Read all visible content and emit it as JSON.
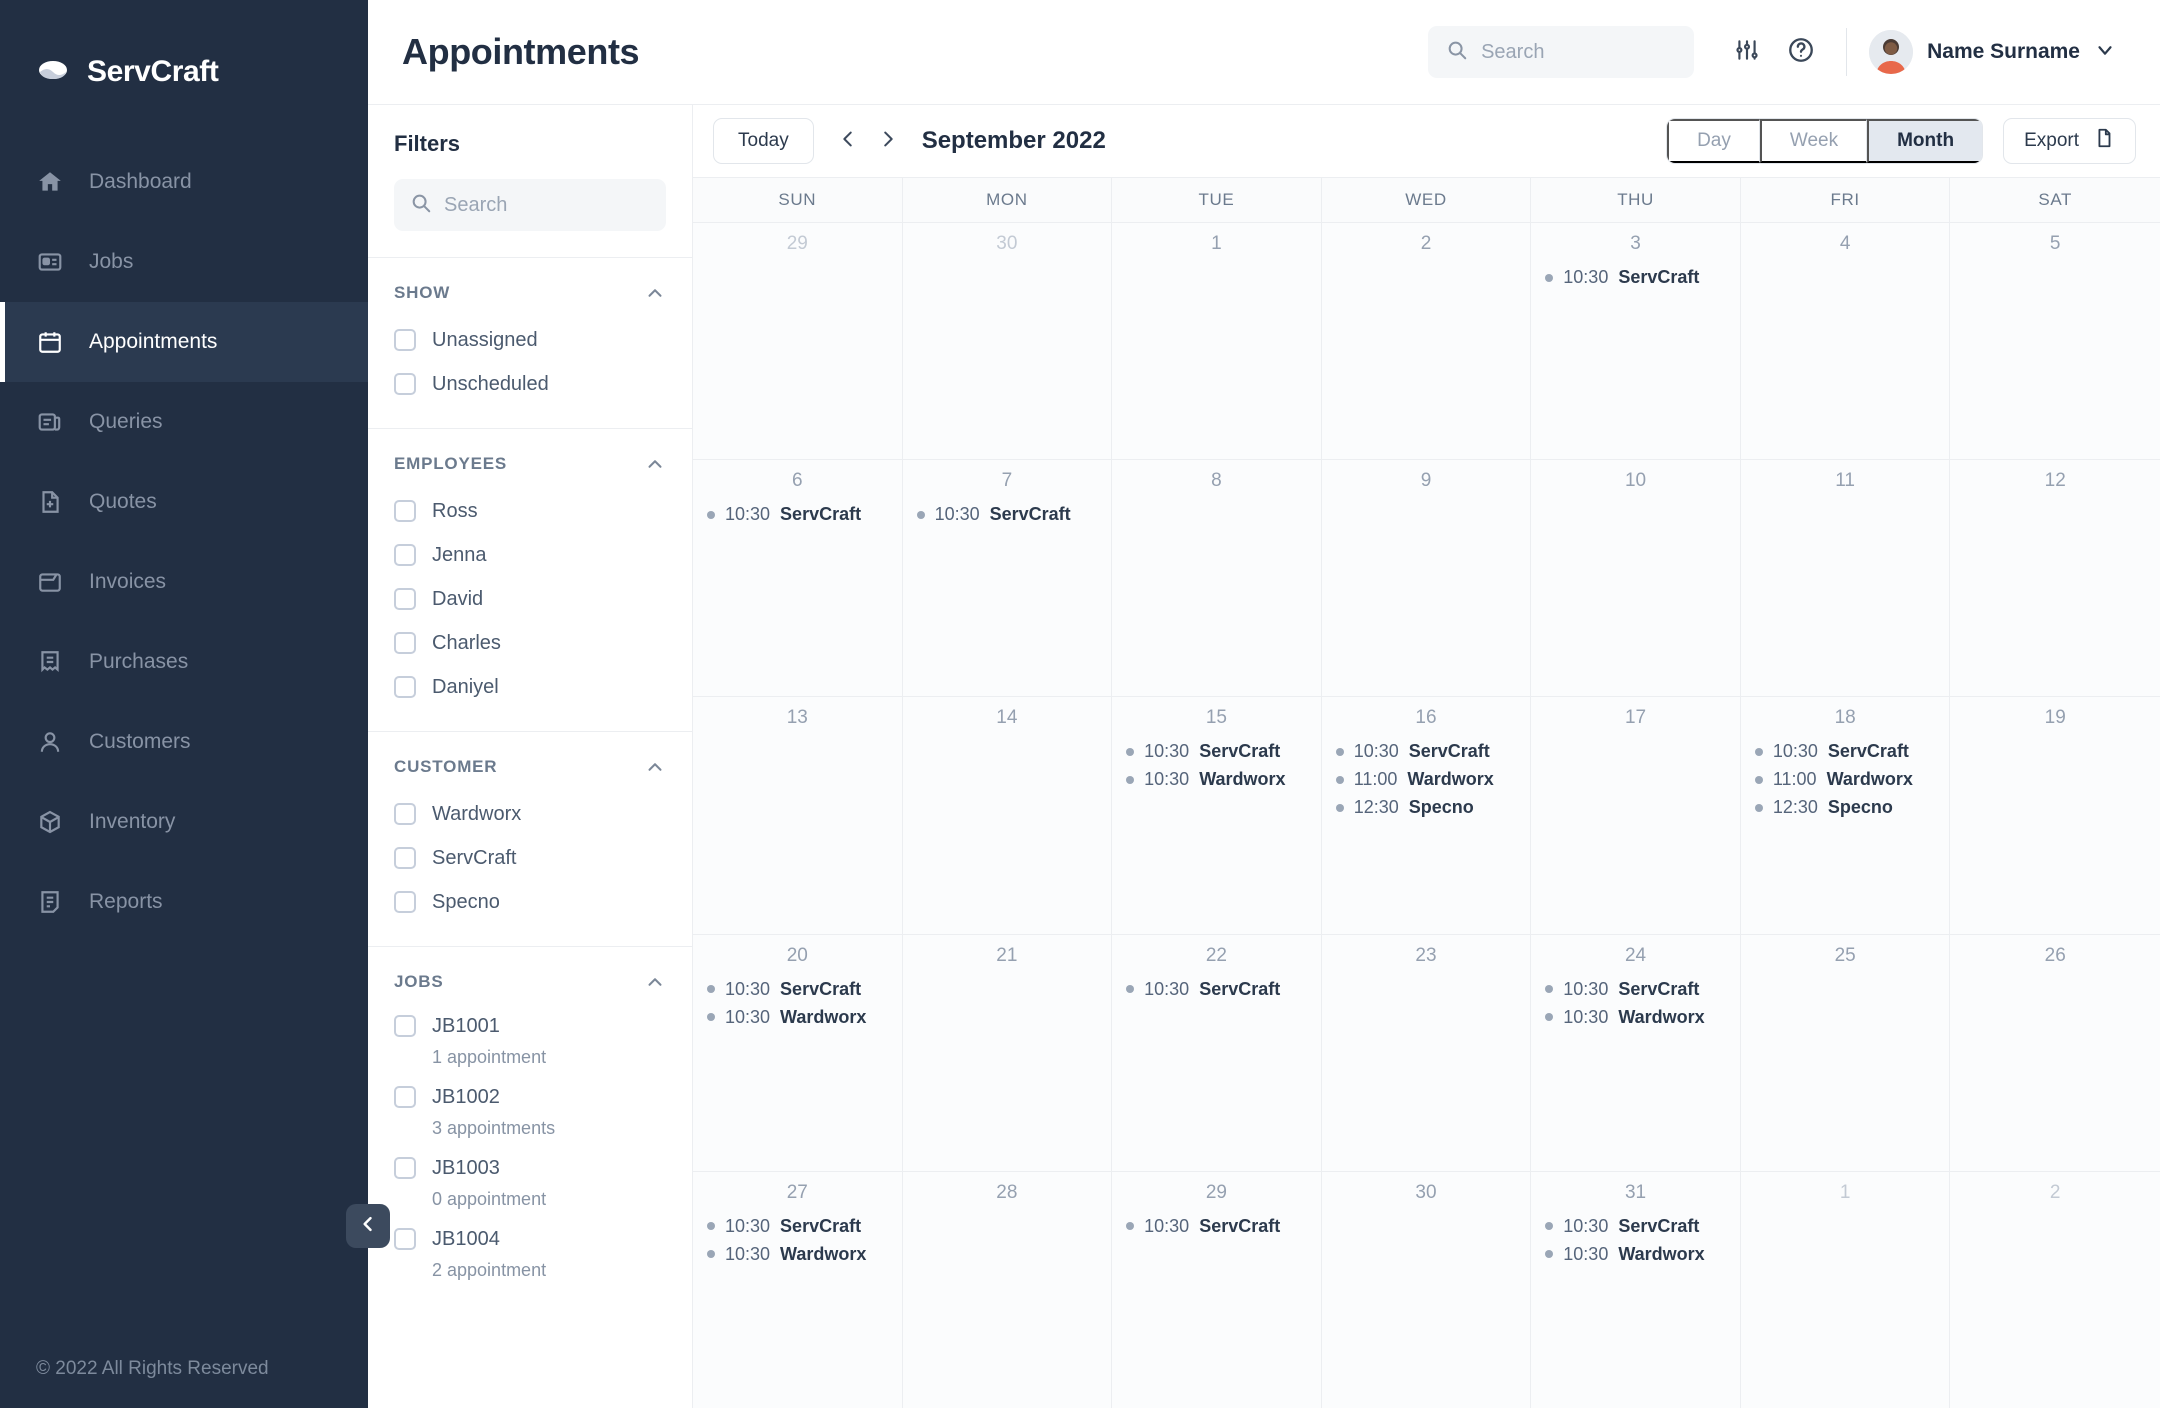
{
  "brand": {
    "name": "ServCraft"
  },
  "sidebar": {
    "items": [
      {
        "label": "Dashboard",
        "icon": "home-icon",
        "active": false
      },
      {
        "label": "Jobs",
        "icon": "jobs-icon",
        "active": false
      },
      {
        "label": "Appointments",
        "icon": "calendar-icon",
        "active": true
      },
      {
        "label": "Queries",
        "icon": "queries-icon",
        "active": false
      },
      {
        "label": "Quotes",
        "icon": "quotes-icon",
        "active": false
      },
      {
        "label": "Invoices",
        "icon": "invoices-icon",
        "active": false
      },
      {
        "label": "Purchases",
        "icon": "purchases-icon",
        "active": false
      },
      {
        "label": "Customers",
        "icon": "customers-icon",
        "active": false
      },
      {
        "label": "Inventory",
        "icon": "inventory-icon",
        "active": false
      },
      {
        "label": "Reports",
        "icon": "reports-icon",
        "active": false
      }
    ],
    "footer": "© 2022 All Rights Reserved",
    "collapse_icon": "chevron-left-icon"
  },
  "header": {
    "title": "Appointments",
    "search": {
      "placeholder": "Search",
      "value": "",
      "icon": "search-icon"
    },
    "settings_icon": "sliders-icon",
    "help_icon": "help-circle-icon",
    "user": {
      "name": "Name Surname",
      "chevron": "chevron-down-icon",
      "avatar": "avatar"
    }
  },
  "filters": {
    "title": "Filters",
    "search": {
      "placeholder": "Search",
      "value": "",
      "icon": "search-icon"
    },
    "groups": [
      {
        "title": "SHOW",
        "collapse_icon": "chevron-up-icon",
        "options": [
          {
            "label": "Unassigned",
            "checked": false
          },
          {
            "label": "Unscheduled",
            "checked": false
          }
        ]
      },
      {
        "title": "EMPLOYEES",
        "collapse_icon": "chevron-up-icon",
        "options": [
          {
            "label": "Ross",
            "checked": false
          },
          {
            "label": "Jenna",
            "checked": false
          },
          {
            "label": "David",
            "checked": false
          },
          {
            "label": "Charles",
            "checked": false
          },
          {
            "label": "Daniyel",
            "checked": false
          }
        ]
      },
      {
        "title": "CUSTOMER",
        "collapse_icon": "chevron-up-icon",
        "options": [
          {
            "label": "Wardworx",
            "checked": false
          },
          {
            "label": "ServCraft",
            "checked": false
          },
          {
            "label": "Specno",
            "checked": false
          }
        ]
      },
      {
        "title": "JOBS",
        "collapse_icon": "chevron-up-icon",
        "options": [
          {
            "label": "JB1001",
            "checked": false,
            "sub": "1 appointment"
          },
          {
            "label": "JB1002",
            "checked": false,
            "sub": "3 appointments"
          },
          {
            "label": "JB1003",
            "checked": false,
            "sub": "0 appointment"
          },
          {
            "label": "JB1004",
            "checked": false,
            "sub": "2 appointment"
          }
        ]
      }
    ]
  },
  "calendar": {
    "today_label": "Today",
    "prev_icon": "chevron-left-icon",
    "next_icon": "chevron-right-icon",
    "month_label": "September 2022",
    "views": [
      {
        "label": "Day",
        "active": false
      },
      {
        "label": "Week",
        "active": false
      },
      {
        "label": "Month",
        "active": true
      }
    ],
    "export_label": "Export",
    "export_icon": "file-export-icon",
    "day_headers": [
      "SUN",
      "MON",
      "TUE",
      "WED",
      "THU",
      "FRI",
      "SAT"
    ],
    "weeks": [
      [
        {
          "num": "29",
          "muted": true,
          "events": []
        },
        {
          "num": "30",
          "muted": true,
          "events": []
        },
        {
          "num": "1",
          "muted": false,
          "events": []
        },
        {
          "num": "2",
          "muted": false,
          "events": []
        },
        {
          "num": "3",
          "muted": false,
          "events": [
            {
              "time": "10:30",
              "title": "ServCraft"
            }
          ]
        },
        {
          "num": "4",
          "muted": false,
          "events": []
        },
        {
          "num": "5",
          "muted": false,
          "events": []
        }
      ],
      [
        {
          "num": "6",
          "muted": false,
          "events": [
            {
              "time": "10:30",
              "title": "ServCraft"
            }
          ]
        },
        {
          "num": "7",
          "muted": false,
          "events": [
            {
              "time": "10:30",
              "title": "ServCraft"
            }
          ]
        },
        {
          "num": "8",
          "muted": false,
          "events": []
        },
        {
          "num": "9",
          "muted": false,
          "events": []
        },
        {
          "num": "10",
          "muted": false,
          "events": []
        },
        {
          "num": "11",
          "muted": false,
          "events": []
        },
        {
          "num": "12",
          "muted": false,
          "events": []
        }
      ],
      [
        {
          "num": "13",
          "muted": false,
          "events": []
        },
        {
          "num": "14",
          "muted": false,
          "events": []
        },
        {
          "num": "15",
          "muted": false,
          "events": [
            {
              "time": "10:30",
              "title": "ServCraft"
            },
            {
              "time": "10:30",
              "title": "Wardworx"
            }
          ]
        },
        {
          "num": "16",
          "muted": false,
          "events": [
            {
              "time": "10:30",
              "title": "ServCraft"
            },
            {
              "time": "11:00",
              "title": "Wardworx"
            },
            {
              "time": "12:30",
              "title": "Specno"
            }
          ]
        },
        {
          "num": "17",
          "muted": false,
          "events": []
        },
        {
          "num": "18",
          "muted": false,
          "events": [
            {
              "time": "10:30",
              "title": "ServCraft"
            },
            {
              "time": "11:00",
              "title": "Wardworx"
            },
            {
              "time": "12:30",
              "title": "Specno"
            }
          ]
        },
        {
          "num": "19",
          "muted": false,
          "events": []
        }
      ],
      [
        {
          "num": "20",
          "muted": false,
          "events": [
            {
              "time": "10:30",
              "title": "ServCraft"
            },
            {
              "time": "10:30",
              "title": "Wardworx"
            }
          ]
        },
        {
          "num": "21",
          "muted": false,
          "events": []
        },
        {
          "num": "22",
          "muted": false,
          "events": [
            {
              "time": "10:30",
              "title": "ServCraft"
            }
          ]
        },
        {
          "num": "23",
          "muted": false,
          "events": []
        },
        {
          "num": "24",
          "muted": false,
          "events": [
            {
              "time": "10:30",
              "title": "ServCraft"
            },
            {
              "time": "10:30",
              "title": "Wardworx"
            }
          ]
        },
        {
          "num": "25",
          "muted": false,
          "events": []
        },
        {
          "num": "26",
          "muted": false,
          "events": []
        }
      ],
      [
        {
          "num": "27",
          "muted": false,
          "events": [
            {
              "time": "10:30",
              "title": "ServCraft"
            },
            {
              "time": "10:30",
              "title": "Wardworx"
            }
          ]
        },
        {
          "num": "28",
          "muted": false,
          "events": []
        },
        {
          "num": "29",
          "muted": false,
          "events": [
            {
              "time": "10:30",
              "title": "ServCraft"
            }
          ]
        },
        {
          "num": "30",
          "muted": false,
          "events": []
        },
        {
          "num": "31",
          "muted": false,
          "events": [
            {
              "time": "10:30",
              "title": "ServCraft"
            },
            {
              "time": "10:30",
              "title": "Wardworx"
            }
          ]
        },
        {
          "num": "1",
          "muted": true,
          "events": []
        },
        {
          "num": "2",
          "muted": true,
          "events": []
        }
      ]
    ]
  },
  "colors": {
    "sidebar_bg": "#222f43",
    "sidebar_active_bg": "#2b3a50",
    "text_dark": "#222f43",
    "muted": "#95a0b0",
    "cell_bg": "#fbfcfd",
    "accent_avatar": "#e8684a"
  }
}
